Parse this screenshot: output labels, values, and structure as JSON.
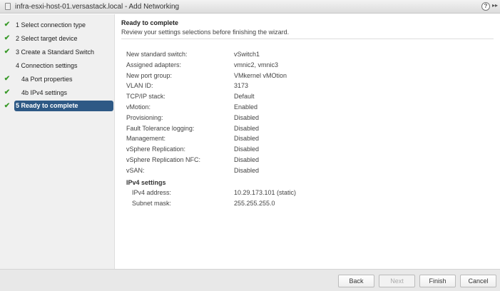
{
  "window": {
    "title": "infra-esxi-host-01.versastack.local - Add Networking"
  },
  "steps": [
    {
      "label": "1  Select connection type",
      "done": true
    },
    {
      "label": "2  Select target device",
      "done": true
    },
    {
      "label": "3  Create a Standard Switch",
      "done": true
    },
    {
      "label": "4  Connection settings",
      "done": false
    },
    {
      "label": "4a  Port properties",
      "done": true,
      "sub": true
    },
    {
      "label": "4b  IPv4 settings",
      "done": true,
      "sub": true
    },
    {
      "label": "5  Ready to complete",
      "done": true,
      "active": true
    }
  ],
  "main": {
    "title": "Ready to complete",
    "subtitle": "Review your settings selections before finishing the wizard.",
    "settings": [
      {
        "k": "New standard switch:",
        "v": "vSwitch1"
      },
      {
        "k": "Assigned adapters:",
        "v": "vmnic2, vmnic3"
      },
      {
        "k": "New port group:",
        "v": "VMkernel vMOtion"
      },
      {
        "k": "VLAN ID:",
        "v": "3173"
      },
      {
        "k": "TCP/IP stack:",
        "v": "Default"
      },
      {
        "k": "vMotion:",
        "v": "Enabled"
      },
      {
        "k": "Provisioning:",
        "v": "Disabled"
      },
      {
        "k": "Fault Tolerance logging:",
        "v": "Disabled"
      },
      {
        "k": "Management:",
        "v": "Disabled"
      },
      {
        "k": "vSphere Replication:",
        "v": "Disabled"
      },
      {
        "k": "vSphere Replication NFC:",
        "v": "Disabled"
      },
      {
        "k": "vSAN:",
        "v": "Disabled"
      }
    ],
    "ipv4_title": "IPv4 settings",
    "ipv4": [
      {
        "k": "IPv4 address:",
        "v": "10.29.173.101 (static)"
      },
      {
        "k": "Subnet mask:",
        "v": "255.255.255.0"
      }
    ]
  },
  "buttons": {
    "back": "Back",
    "next": "Next",
    "finish": "Finish",
    "cancel": "Cancel"
  },
  "icons": {
    "help": "?",
    "more": "▸▸",
    "check": "✔"
  }
}
